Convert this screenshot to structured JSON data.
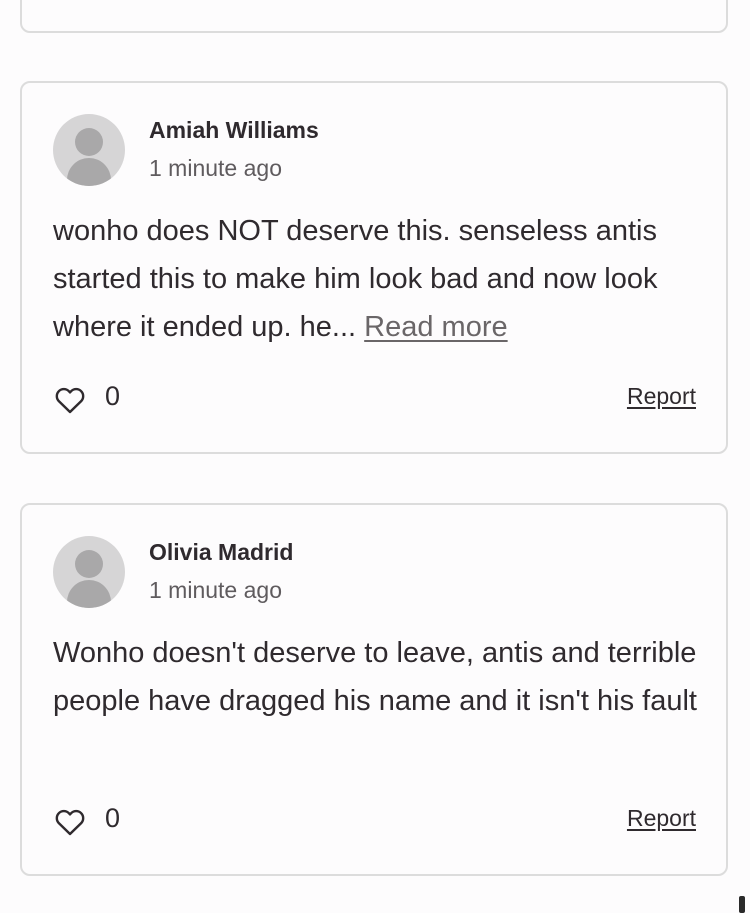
{
  "comments": [
    {
      "author": "Amiah Williams",
      "time": "1 minute ago",
      "text": "wonho does NOT deserve this. senseless antis started this to make him look bad and now look where it ended up. he...",
      "read_more": "Read more",
      "likes": "0",
      "report_label": "Report"
    },
    {
      "author": "Olivia Madrid",
      "time": "1 minute ago",
      "text": "Wonho doesn't deserve to leave, antis and terrible people have dragged his name and it isn't his fault",
      "likes": "0",
      "report_label": "Report"
    }
  ],
  "icons": {
    "avatar": "user-avatar-placeholder",
    "like": "heart-outline-icon"
  },
  "colors": {
    "border": "#dcdcdc",
    "text": "#2f2a2e",
    "muted": "#5f5b5e",
    "avatar_bg": "#d6d5d6",
    "avatar_fg": "#a9a8a9"
  }
}
